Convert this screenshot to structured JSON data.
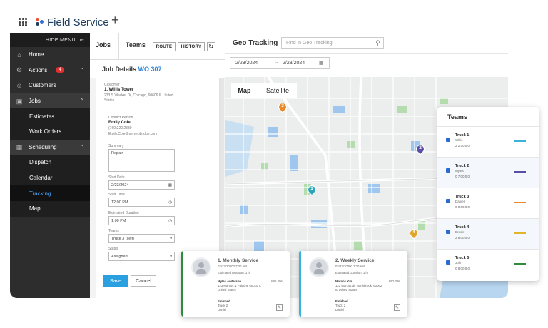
{
  "app": {
    "name": "Field Service",
    "add_tab": "+"
  },
  "sidebar": {
    "hide_menu": "HIDE MENU",
    "items": [
      {
        "label": "Home",
        "icon": "home-icon"
      },
      {
        "label": "Actions",
        "icon": "actions-icon",
        "badge": "4"
      },
      {
        "label": "Customers",
        "icon": "customers-icon"
      },
      {
        "label": "Jobs",
        "icon": "jobs-icon"
      },
      {
        "label": "Estimates"
      },
      {
        "label": "Work Orders"
      },
      {
        "label": "Scheduling",
        "icon": "calendar-icon"
      },
      {
        "label": "Dispatch"
      },
      {
        "label": "Calendar"
      },
      {
        "label": "Tracking"
      },
      {
        "label": "Map"
      }
    ]
  },
  "panel": {
    "tabs": [
      "Jobs",
      "Teams"
    ],
    "buttons": {
      "route": "ROUTE",
      "history": "HISTORY"
    },
    "job_details_label": "Job Details",
    "job_id": "WO 307",
    "form": {
      "customer_label": "Customer",
      "customer_name": "1. Willis Tower",
      "customer_address": "233 S Wacker Dr, Chicago, 60606 IL United States",
      "contact_label": "Contact Person",
      "contact_name": "Emily Cole",
      "contact_phone": "(760)220 2330",
      "contact_email": "Emily.Cole@serveobridge.com",
      "summary_label": "Summary",
      "summary_value": "Repair",
      "start_date_label": "Start Date",
      "start_date_value": "2/23/2024",
      "start_time_label": "Start Time",
      "start_time_value": "12:00 PM",
      "duration_label": "Estimated Duration",
      "duration_value": "1:00 PM",
      "teams_label": "Teams",
      "teams_value": "Truck 3 (self)",
      "status_label": "Status",
      "status_value": "Assigned",
      "save": "Save",
      "cancel": "Cancel"
    }
  },
  "geo": {
    "title": "Geo Tracking",
    "search_placeholder": "Find in Geo Tracking",
    "date_from": "2/23/2024",
    "date_to": "2/23/2024",
    "map_type_map": "Map",
    "map_type_satellite": "Satellite",
    "pins": [
      "1",
      "2",
      "3",
      "4"
    ],
    "pin_colors": [
      "#2aa6b8",
      "#5b4fa3",
      "#e8892b",
      "#e0a52a"
    ]
  },
  "teams": {
    "title": "Teams",
    "trucks": [
      {
        "name": "Truck 1",
        "sub": "Willis",
        "stats": "2   2:30   0.0",
        "color": "#39b3d7"
      },
      {
        "name": "Truck 2",
        "sub": "Myles",
        "stats": "0   7:00   0.0",
        "color": "#5b4fa3"
      },
      {
        "name": "Truck 3",
        "sub": "Daniel",
        "stats": "0   8:00   0.0",
        "color": "#e8892b"
      },
      {
        "name": "Truck 4",
        "sub": "Brook",
        "stats": "2   8:00   0.0",
        "color": "#e0b52a"
      },
      {
        "name": "Truck 5",
        "sub": "John",
        "stats": "0   8:00   0.0",
        "color": "#2e8b3a"
      }
    ]
  },
  "services": [
    {
      "title": "1. Monthly Service",
      "date": "02/23/20000 7:30 AM",
      "duration": "Estimated Duration: 1 hr",
      "customer": "Myles Anderson",
      "wo": "WO 296",
      "address": "123 Marcos & Palatine 60010 IL United States",
      "status": "Finished",
      "truck": "Truck 2",
      "person": "Daniel",
      "color": "#2e8b3a"
    },
    {
      "title": "2. Weekly Service",
      "date": "02/23/20000 7:30 AM",
      "duration": "Estimated Duration: 1 hr",
      "customer": "Marcos Kils",
      "wo": "WO 298",
      "address": "122 Marcos dr, Northbrook, 60062 IL United States",
      "status": "Finished",
      "truck": "Truck 2",
      "person": "Daniel",
      "color": "#39b3d7"
    }
  ]
}
